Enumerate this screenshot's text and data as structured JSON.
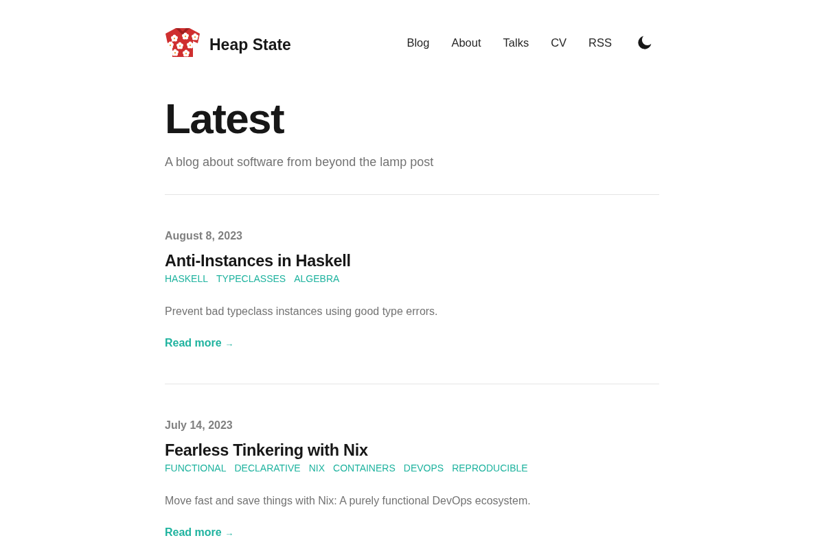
{
  "site": {
    "title": "Heap State"
  },
  "nav": [
    "Blog",
    "About",
    "Talks",
    "CV",
    "RSS"
  ],
  "page": {
    "heading": "Latest",
    "subtitle": "A blog about software from beyond the lamp post"
  },
  "posts": [
    {
      "date": "August 8, 2023",
      "title": "Anti-Instances in Haskell",
      "tags": [
        "HASKELL",
        "TYPECLASSES",
        "ALGEBRA"
      ],
      "summary": "Prevent bad typeclass instances using good type errors.",
      "link": "Read more",
      "arrow": "→"
    },
    {
      "date": "July 14, 2023",
      "title": "Fearless Tinkering with Nix",
      "tags": [
        "FUNCTIONAL",
        "DECLARATIVE",
        "NIX",
        "CONTAINERS",
        "DEVOPS",
        "REPRODUCIBLE"
      ],
      "summary": "Move fast and save things with Nix: A purely functional DevOps ecosystem.",
      "link": "Read more",
      "arrow": "→"
    }
  ]
}
